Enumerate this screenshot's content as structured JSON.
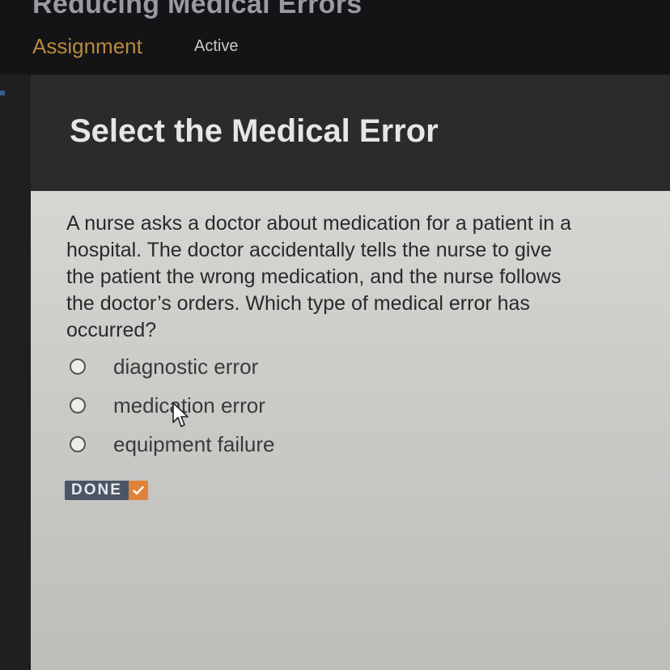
{
  "header": {
    "course_title": "Reducing Medical Errors",
    "assignment_label": "Assignment",
    "status_label": "Active"
  },
  "section": {
    "title": "Select the Medical Error"
  },
  "question": {
    "text": "A nurse asks a doctor about medication for a patient in a hospital. The doctor accidentally tells the nurse to give the patient the wrong medication, and the nurse follows the doctor’s orders. Which type of medical error has occurred?",
    "options": [
      {
        "label": "diagnostic error",
        "selected": false
      },
      {
        "label": "medication error",
        "selected": false
      },
      {
        "label": "equipment failure",
        "selected": false
      }
    ]
  },
  "done_button": {
    "label": "DONE",
    "icon": "check-icon"
  },
  "colors": {
    "assignment_accent": "#b88a3c",
    "done_check": "#e0823a",
    "done_bg": "#4a5566",
    "panel_bg": "#cfcfcc"
  }
}
